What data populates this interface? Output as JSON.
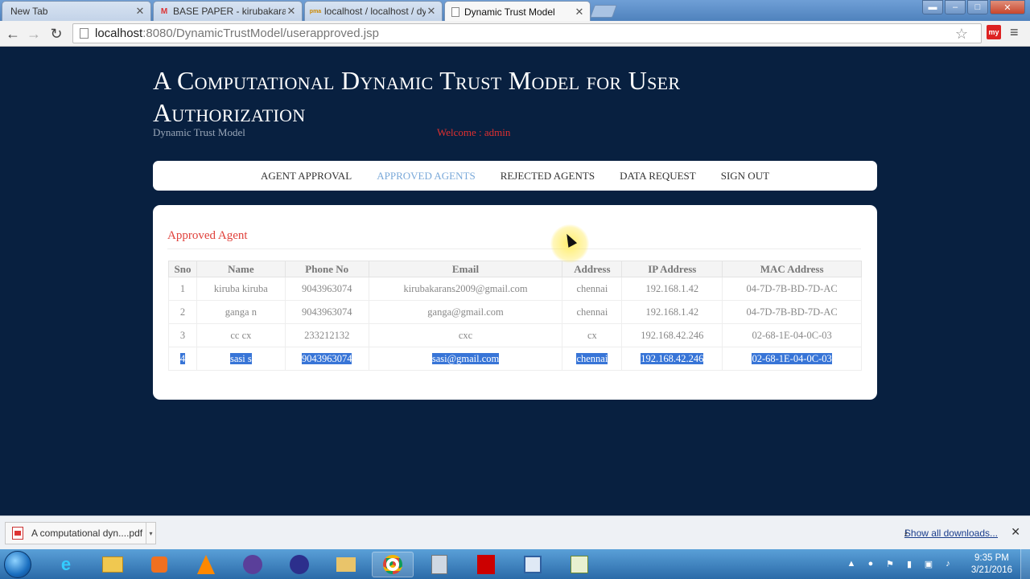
{
  "browser": {
    "tabs": [
      {
        "title": "New Tab",
        "favicon": "",
        "active": false
      },
      {
        "title": "BASE PAPER - kirubakaran",
        "favicon": "M",
        "active": false
      },
      {
        "title": "localhost / localhost / dyn",
        "favicon": "pma",
        "active": false
      },
      {
        "title": "Dynamic Trust Model",
        "favicon": "",
        "active": true
      }
    ],
    "url_host": "localhost",
    "url_path": ":8080/DynamicTrustModel/userapproved.jsp"
  },
  "site": {
    "title": "A Computational Dynamic Trust Model for User Authorization",
    "subtitle": "Dynamic Trust Model",
    "welcome": "Welcome : admin"
  },
  "menu": [
    {
      "label": "AGENT APPROVAL",
      "active": false
    },
    {
      "label": "APPROVED AGENTS",
      "active": true
    },
    {
      "label": "REJECTED AGENTS",
      "active": false
    },
    {
      "label": "DATA REQUEST",
      "active": false
    },
    {
      "label": "SIGN OUT",
      "active": false
    }
  ],
  "panel": {
    "title": "Approved Agent",
    "columns": [
      "Sno",
      "Name",
      "Phone No",
      "Email",
      "Address",
      "IP Address",
      "MAC Address"
    ],
    "rows": [
      [
        "1",
        "kiruba kiruba",
        "9043963074",
        "kirubakarans2009@gmail.com",
        "chennai",
        "192.168.1.42",
        "04-7D-7B-BD-7D-AC"
      ],
      [
        "2",
        "ganga n",
        "9043963074",
        "ganga@gmail.com",
        "chennai",
        "192.168.1.42",
        "04-7D-7B-BD-7D-AC"
      ],
      [
        "3",
        "cc cx",
        "233212132",
        "cxc",
        "cx",
        "192.168.42.246",
        "02-68-1E-04-0C-03"
      ],
      [
        "4",
        "sasi s",
        "9043963074",
        "sasi@gmail.com",
        "chennai",
        "192.168.42.246",
        "02-68-1E-04-0C-03"
      ]
    ],
    "selected_row": 4
  },
  "downloads": {
    "item": "A computational dyn....pdf",
    "show_all": "Show all downloads..."
  },
  "taskbar": {
    "time": "9:35 PM",
    "date": "3/21/2016"
  }
}
